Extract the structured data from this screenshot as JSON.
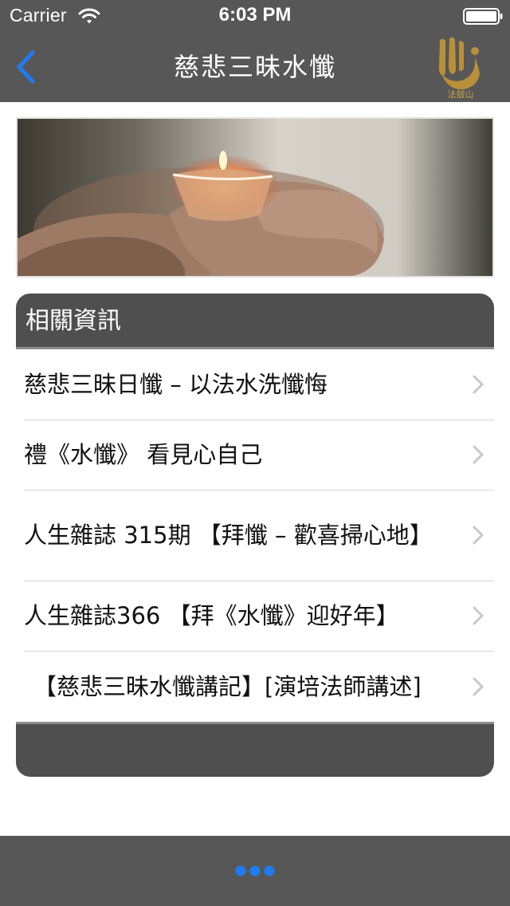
{
  "status_bar": {
    "carrier": "Carrier",
    "time": "6:03 PM",
    "icons": [
      "wifi-icon",
      "battery-icon"
    ]
  },
  "nav": {
    "title": "慈悲三昧水懺",
    "back_icon": "chevron-left-icon",
    "logo_caption": "法鼓山"
  },
  "panel": {
    "header": "相關資訊",
    "items": [
      {
        "label": "慈悲三昧日懺 – 以法水洗懺悔"
      },
      {
        "label": "禮《水懺》 看見心自己"
      },
      {
        "label": "人生雜誌 315期 【拜懺 – 歡喜掃心地】"
      },
      {
        "label": "人生雜誌366 【拜《水懺》迎好年】"
      },
      {
        "label": "【慈悲三昧水懺講記】[演培法師講述]"
      }
    ]
  },
  "bottom_bar": {
    "more_icon": "ellipsis-icon"
  },
  "colors": {
    "bar": "#575757",
    "panel": "#4f4f4f",
    "accent": "#1d7cf2",
    "logo": "#b9903a"
  }
}
